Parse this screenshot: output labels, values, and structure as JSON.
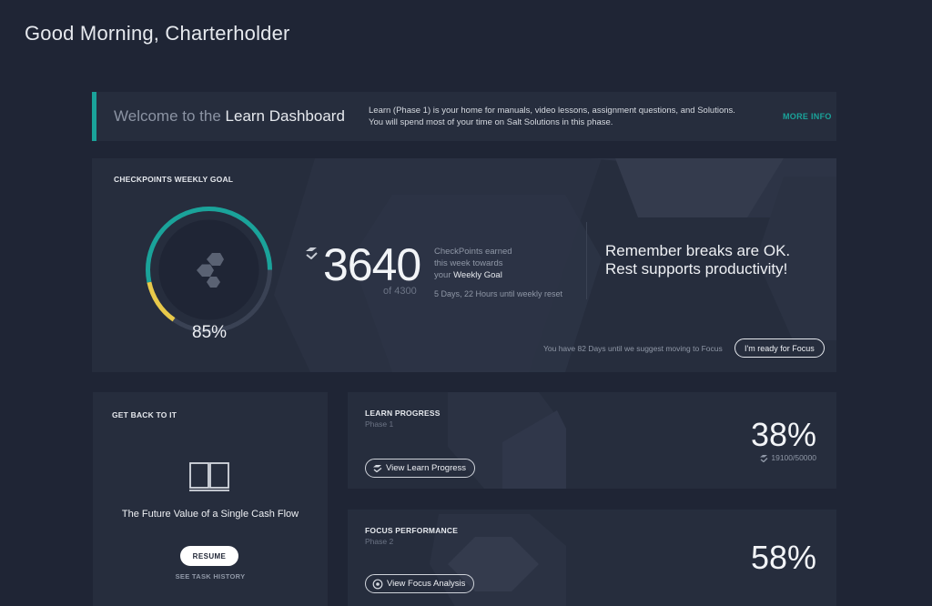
{
  "greeting": "Good Morning, Charterholder",
  "welcome": {
    "title_prefix": "Welcome to the ",
    "title_strong": "Learn Dashboard",
    "description_line1": "Learn (Phase 1) is your home for manuals, video lessons, assignment questions, and Solutions.",
    "description_line2": "You will spend most of your time on Salt Solutions in this phase.",
    "more_info": "MORE INFO"
  },
  "checkpoints": {
    "label": "CHECKPOINTS WEEKLY GOAL",
    "earned": "3640",
    "of_total": "of 4300",
    "percent_label": "85%",
    "percent": 0.85,
    "desc_line1": "CheckPoints earned",
    "desc_line2": "this week towards",
    "desc_line3_prefix": "your ",
    "desc_line3_strong": "Weekly Goal",
    "reset_text": "5 Days, 22 Hours until weekly reset",
    "quote_line1": "Remember breaks are OK.",
    "quote_line2": "Rest supports productivity!",
    "until_focus": "You have 82 Days until we suggest moving to Focus",
    "ready_button": "I'm ready for Focus"
  },
  "get_back": {
    "label": "GET BACK TO IT",
    "task_title": "The Future Value of a Single Cash Flow",
    "resume_button": "RESUME",
    "history_link": "SEE TASK HISTORY"
  },
  "learn_progress": {
    "title": "LEARN PROGRESS",
    "phase": "Phase 1",
    "percent": "38%",
    "count": "19100/50000",
    "button": "View Learn Progress"
  },
  "focus_performance": {
    "title": "FOCUS PERFORMANCE",
    "phase": "Phase 2",
    "percent": "58%",
    "button": "View Focus Analysis"
  },
  "colors": {
    "background": "#1f2535",
    "card": "#262d3d",
    "accent_teal": "#1aa39a",
    "accent_yellow": "#e8c94a"
  }
}
